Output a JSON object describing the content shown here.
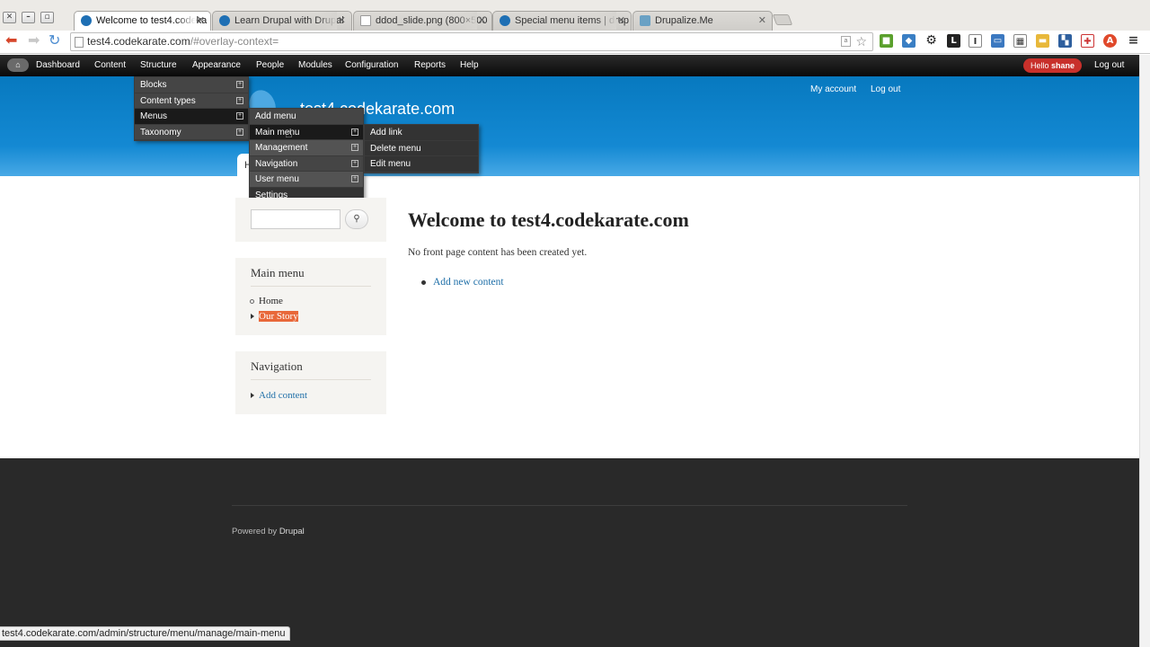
{
  "browser": {
    "tabs": [
      {
        "label": "Welcome to test4.codeka",
        "active": true
      },
      {
        "label": "Learn Drupal with Drupal",
        "active": false
      },
      {
        "label": "ddod_slide.png (800×500",
        "active": false
      },
      {
        "label": "Special menu items | drup",
        "active": false
      },
      {
        "label": "Drupalize.Me",
        "active": false
      }
    ],
    "url_host": "test4.codekarate.com",
    "url_rest": "/#overlay-context=",
    "status_url": "test4.codekarate.com/admin/structure/menu/manage/main-menu"
  },
  "admin_toolbar": {
    "items": [
      "Dashboard",
      "Content",
      "Structure",
      "Appearance",
      "People",
      "Modules",
      "Configuration",
      "Reports",
      "Help"
    ],
    "hello": "Hello",
    "user": "shane",
    "logout": "Log out"
  },
  "structure_menu": [
    "Blocks",
    "Content types",
    "Menus",
    "Taxonomy"
  ],
  "menus_menu": [
    "Add menu",
    "Main menu",
    "Management",
    "Navigation",
    "User menu",
    "Settings"
  ],
  "main_menu_submenu": [
    "Add link",
    "Delete menu",
    "Edit menu"
  ],
  "header": {
    "site_name": "test4.codekarate.com",
    "my_account": "My account",
    "log_out": "Log out",
    "home_tab": "H"
  },
  "sidebar": {
    "main_menu_title": "Main menu",
    "main_menu_items": [
      "Home",
      "Our Story"
    ],
    "navigation_title": "Navigation",
    "navigation_items": [
      "Add content"
    ]
  },
  "main": {
    "title": "Welcome to test4.codekarate.com",
    "text": "No front page content has been created yet.",
    "link": "Add new content"
  },
  "footer": {
    "powered_by": "Powered by",
    "drupal": "Drupal"
  }
}
